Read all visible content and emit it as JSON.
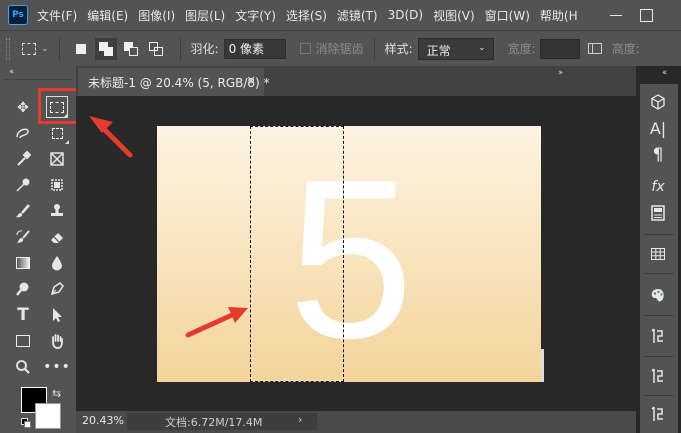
{
  "app": {
    "logo": "Ps"
  },
  "menu": [
    "文件(F)",
    "编辑(E)",
    "图像(I)",
    "图层(L)",
    "文字(Y)",
    "选择(S)",
    "滤镜(T)",
    "3D(D)",
    "视图(V)",
    "窗口(W)",
    "帮助(H"
  ],
  "options": {
    "feather_label": "羽化:",
    "feather_value": "0 像素",
    "antialias_label": "消除锯齿",
    "style_label": "样式:",
    "style_value": "正常",
    "width_label": "宽度:",
    "height_label": "高度:"
  },
  "document": {
    "tab_title": "未标题-1 @ 20.4% (5, RGB/8) *",
    "close_glyph": "×",
    "canvas_text": "5",
    "canvas_gradient": [
      "#fdf3e2",
      "#f3d49b"
    ]
  },
  "status": {
    "zoom": "20.43%",
    "doc_info": "文档:6.72M/17.4M",
    "arrow": "›"
  },
  "colors": {
    "foreground": "#000000",
    "background": "#ffffff",
    "annotation_red": "#e53a2f"
  },
  "tools": [
    "move-icon",
    "rect-marquee-icon",
    "lasso-icon",
    "object-select-icon",
    "eyedropper-icon",
    "frame-icon",
    "healing-icon",
    "crop-icon",
    "brush-icon",
    "stamp-icon",
    "history-brush-icon",
    "eraser-icon",
    "gradient-icon",
    "blur-icon",
    "dodge-icon",
    "pen-icon",
    "type-icon",
    "path-select-icon",
    "rectangle-icon",
    "hand-icon",
    "zoom-icon",
    "more-icon"
  ],
  "right_panels": [
    "3d-icon",
    "character-icon",
    "paragraph-icon",
    "fx-icon",
    "properties-icon",
    "swatches-icon",
    "color-palette-icon",
    "history-icon",
    "history-icon",
    "history-icon"
  ]
}
